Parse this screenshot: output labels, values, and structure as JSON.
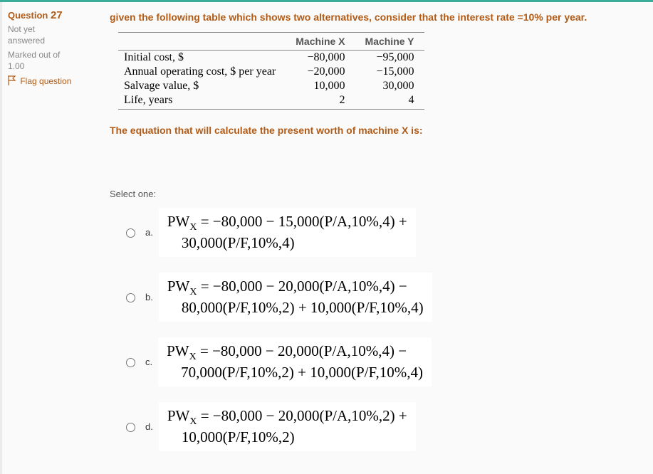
{
  "sidebar": {
    "question_label": "Question",
    "question_number": "27",
    "status1": "Not yet",
    "status2": "answered",
    "marked_out": "Marked out of",
    "marked_out_val": "1.00",
    "flag_text": "Flag question"
  },
  "stem": {
    "line1": "given the following table which shows two alternatives, consider that the interest rate =10% per year.",
    "line2": "The equation that will calculate the present worth of machine X is:"
  },
  "table": {
    "header_col1": "",
    "header_col2": "Machine X",
    "header_col3": "Machine Y",
    "rows": [
      {
        "label": "Initial cost, $",
        "x": "−80,000",
        "y": "−95,000"
      },
      {
        "label": "Annual operating cost, $ per year",
        "x": "−20,000",
        "y": "−15,000"
      },
      {
        "label": "Salvage value, $",
        "x": "10,000",
        "y": "30,000"
      },
      {
        "label": "Life, years",
        "x": "2",
        "y": "4"
      }
    ]
  },
  "select_one": "Select one:",
  "options": {
    "a": {
      "letter": "a.",
      "eq_l1": "PW",
      "eq_l1b": " = −80,000 − 15,000(P/A,10%,4) +",
      "eq_l2": "30,000(P/F,10%,4)"
    },
    "b": {
      "letter": "b.",
      "eq_l1": "PW",
      "eq_l1b": " = −80,000 − 20,000(P/A,10%,4) −",
      "eq_l2": "80,000(P/F,10%,2) + 10,000(P/F,10%,4)"
    },
    "c": {
      "letter": "c.",
      "eq_l1": "PW",
      "eq_l1b": " = −80,000 − 20,000(P/A,10%,4) −",
      "eq_l2": "70,000(P/F,10%,2) + 10,000(P/F,10%,4)"
    },
    "d": {
      "letter": "d.",
      "eq_l1": "PW",
      "eq_l1b": " = −80,000 − 20,000(P/A,10%,2) +",
      "eq_l2": "10,000(P/F,10%,2)"
    }
  }
}
